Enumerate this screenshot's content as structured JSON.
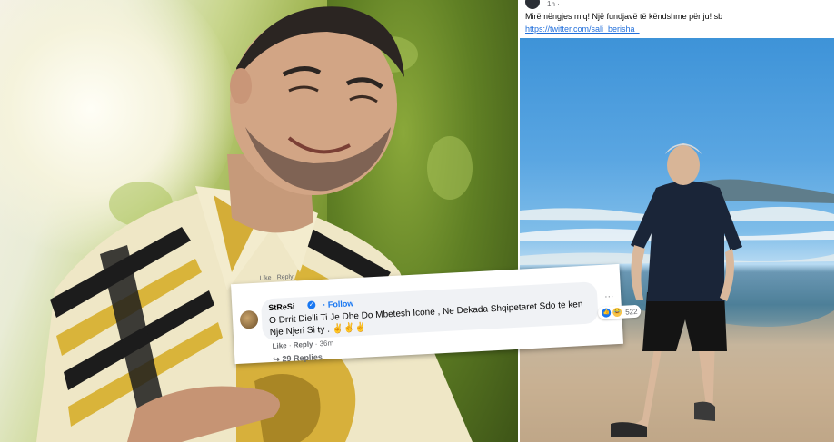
{
  "post": {
    "time": "1h · ",
    "text": "Mirëmëngjes miq! Një fundjavë të këndshme për ju! sb",
    "link": "https://twitter.com/sali_berisha_"
  },
  "comment": {
    "top_strip": "Like · Reply",
    "name": "StReSi",
    "verified_icon": "✓",
    "follow": "· Follow",
    "text": "O Drrit Dielli Ti Je Dhe Do Mbetesh Icone , Ne Dekada Shqipetaret Sdo te ken Nje Njeri Si ty .",
    "emoji": "✌✌✌",
    "reactions": {
      "like_icon": "👍",
      "haha_icon": "😂",
      "count": "522"
    },
    "more": "···",
    "actions": {
      "like": "Like",
      "reply": "Reply",
      "time": "36m"
    },
    "replies": "29 Replies",
    "replies_icon": "↪"
  }
}
